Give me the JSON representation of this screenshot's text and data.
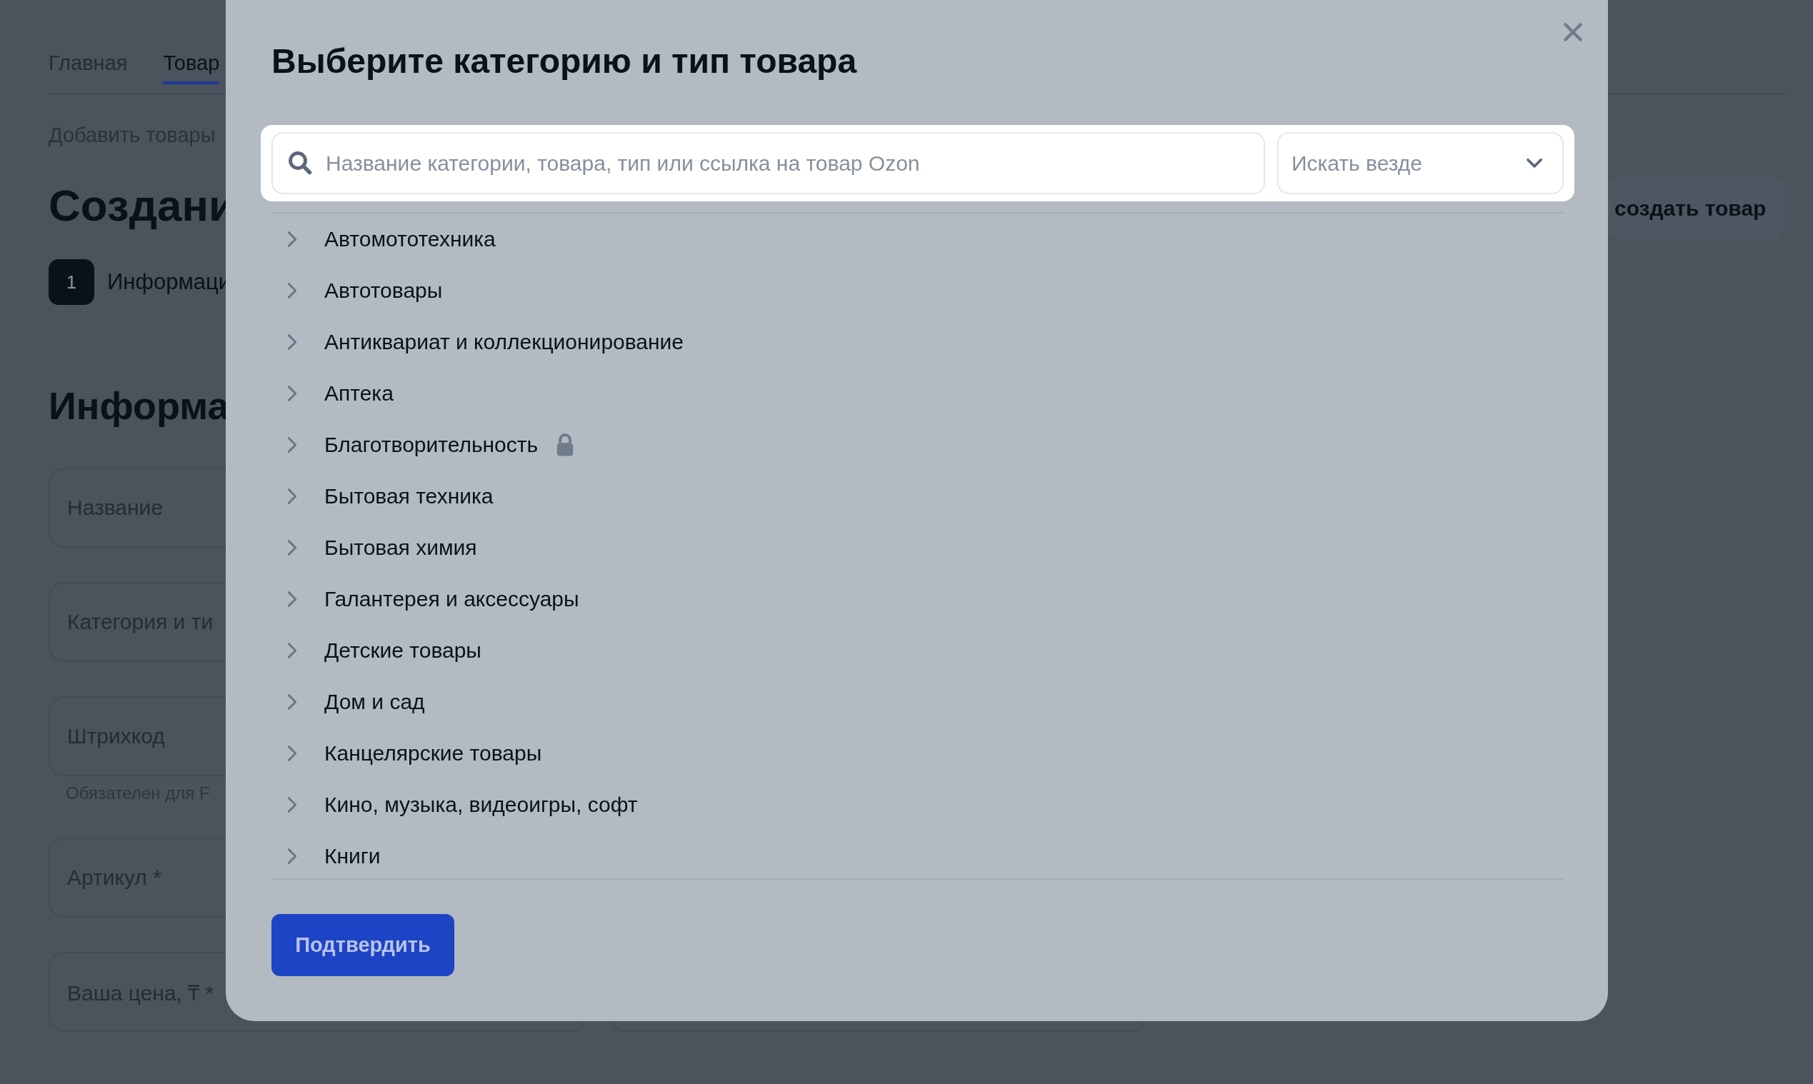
{
  "page": {
    "tabs": [
      {
        "label": "Главная",
        "selected": false
      },
      {
        "label": "Товар",
        "selected": true
      }
    ],
    "breadcrumb": "Добавить товары",
    "title": "Создани",
    "step": {
      "number": "1",
      "label": "Информаци"
    },
    "section_title": "Информа",
    "fields": [
      {
        "label": "Название"
      },
      {
        "label": "Категория и ти"
      },
      {
        "label": "Штрихкод",
        "hint": "Обязателен для F"
      },
      {
        "label": "Артикул *"
      },
      {
        "label": "Ваша цена, ₸ *"
      }
    ],
    "create_button": "создать товар"
  },
  "modal": {
    "title": "Выберите категорию и тип товара",
    "search": {
      "placeholder": "Название категории, товара, тип или ссылка на товар Ozon"
    },
    "scope": {
      "value": "Искать везде"
    },
    "categories": [
      {
        "label": "Автомототехника",
        "locked": false
      },
      {
        "label": "Автотовары",
        "locked": false
      },
      {
        "label": "Антиквариат и коллекционирование",
        "locked": false
      },
      {
        "label": "Аптека",
        "locked": false
      },
      {
        "label": "Благотворительность",
        "locked": true
      },
      {
        "label": "Бытовая техника",
        "locked": false
      },
      {
        "label": "Бытовая химия",
        "locked": false
      },
      {
        "label": "Галантерея и аксессуары",
        "locked": false
      },
      {
        "label": "Детские товары",
        "locked": false
      },
      {
        "label": "Дом и сад",
        "locked": false
      },
      {
        "label": "Канцелярские товары",
        "locked": false
      },
      {
        "label": "Кино, музыка, видеоигры, софт",
        "locked": false
      },
      {
        "label": "Книги",
        "locked": false
      }
    ],
    "confirm_button": "Подтвердить"
  }
}
